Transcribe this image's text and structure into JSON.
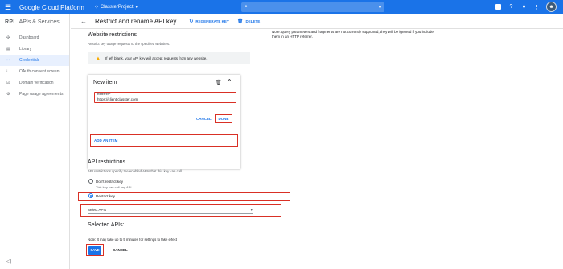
{
  "topbar": {
    "menu_icon": "hamburger-icon",
    "brand": "Google Cloud Platform",
    "project": "ClassterProject",
    "search_placeholder": "",
    "icons": [
      "gift-icon",
      "help-icon",
      "bell-icon",
      "more-icon"
    ]
  },
  "sidebar": {
    "badge": "RPI",
    "title": "APIs & Services",
    "items": [
      {
        "label": "Dashboard",
        "icon": "dashboard-icon"
      },
      {
        "label": "Library",
        "icon": "library-icon"
      },
      {
        "label": "Credentials",
        "icon": "key-icon"
      },
      {
        "label": "OAuth consent screen",
        "icon": "consent-icon"
      },
      {
        "label": "Domain verification",
        "icon": "checkbox-icon"
      },
      {
        "label": "Page usage agreements",
        "icon": "settings-list-icon"
      }
    ],
    "collapse_label": "◁|"
  },
  "header": {
    "title": "Restrict and rename API key",
    "regenerate": "REGENERATE KEY",
    "delete": "DELETE"
  },
  "content": {
    "website_title": "Website restrictions",
    "website_sub": "Restrict key usage requests to the specified websites.",
    "warning": "If left blank, your API key will accept requests from any website.",
    "new_item_title": "New item",
    "referrer_label": "Referrer *",
    "referrer_value": "https://client.classter.com",
    "cancel": "CANCEL",
    "done": "DONE",
    "add_item": "ADD AN ITEM",
    "note_right": "Note: query parameters and fragments are not currently supported; they will be ignored if you include them in an HTTP referrer.",
    "api_title": "API restrictions",
    "api_sub": "API restrictions specify the enabled APIs that this key can call",
    "dont_restrict": "Don't restrict key",
    "dont_restrict_sub": "This key can call any API",
    "restrict": "Restrict key",
    "select_apis": "Select APIs",
    "selected_title": "Selected APIs:",
    "note_bottom": "Note: It may take up to 5 minutes for settings to take effect",
    "save": "SAVE",
    "cancel_bottom": "CANCEL"
  },
  "colors": {
    "brand": "#1a73e8",
    "highlight": "#d93025",
    "warning": "#f9ab00"
  }
}
